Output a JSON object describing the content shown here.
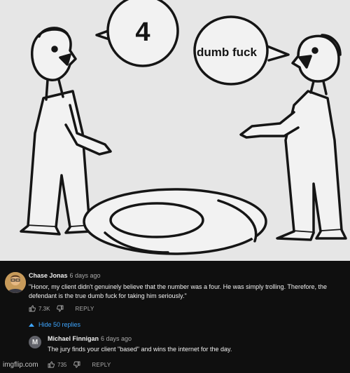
{
  "meme": {
    "bubble_left_text": "4",
    "bubble_right_text": "dumb fuck"
  },
  "comments": [
    {
      "author": "Chase Jonas",
      "time": "6 days ago",
      "text": "\"Honor, my client didn't genuinely believe that the number was a four. He was simply trolling. Therefore, the defendant is the true dumb fuck for taking him seriously.\"",
      "likes": "7.3K",
      "reply_label": "REPLY"
    },
    {
      "author": "Michael Finnigan",
      "avatar_letter": "M",
      "time": "6 days ago",
      "text": "The jury finds your client \"based\" and wins the internet for the day.",
      "likes": "735",
      "reply_label": "REPLY"
    }
  ],
  "hide_replies_label": "Hide 50 replies",
  "watermark": "imgflip.com",
  "colors": {
    "background": "#0f0f0f",
    "link": "#3ea6ff",
    "meme_bg": "#e6e6e6"
  }
}
